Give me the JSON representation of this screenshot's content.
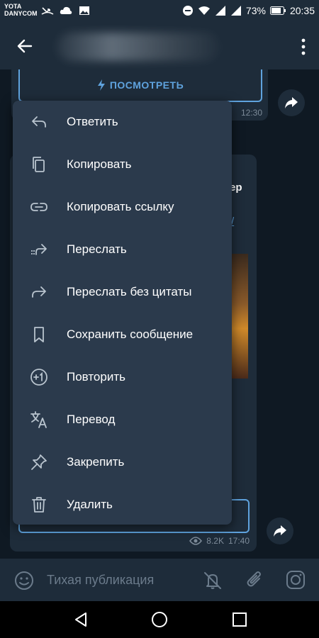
{
  "status_bar": {
    "carrier_line1": "YOTA",
    "carrier_line2": "DANYCOM",
    "battery": "73%",
    "time": "20:35"
  },
  "header": {
    "back_icon": "arrow-left-icon",
    "menu_icon": "more-vertical-icon"
  },
  "messages": {
    "first": {
      "button_label": "ПОСМОТРЕТЬ",
      "time": "12:30"
    },
    "second": {
      "partial_title": "ер",
      "partial_link": "/",
      "views": "8.2K",
      "time": "17:40"
    }
  },
  "context_menu": {
    "items": [
      {
        "label": "Ответить",
        "icon": "reply-icon"
      },
      {
        "label": "Копировать",
        "icon": "copy-icon"
      },
      {
        "label": "Копировать ссылку",
        "icon": "link-icon"
      },
      {
        "label": "Переслать",
        "icon": "forward-multiple-icon"
      },
      {
        "label": "Переслать без цитаты",
        "icon": "forward-icon"
      },
      {
        "label": "Сохранить сообщение",
        "icon": "bookmark-icon"
      },
      {
        "label": "Повторить",
        "icon": "plus-one-icon"
      },
      {
        "label": "Перевод",
        "icon": "translate-icon"
      },
      {
        "label": "Закрепить",
        "icon": "pin-icon"
      },
      {
        "label": "Удалить",
        "icon": "trash-icon"
      }
    ]
  },
  "input_bar": {
    "placeholder": "Тихая публикация"
  },
  "colors": {
    "accent": "#5fa3de",
    "menu_bg": "#2b3a4c",
    "bar_bg": "#1e2c3a",
    "chat_bg": "#0f1923"
  }
}
